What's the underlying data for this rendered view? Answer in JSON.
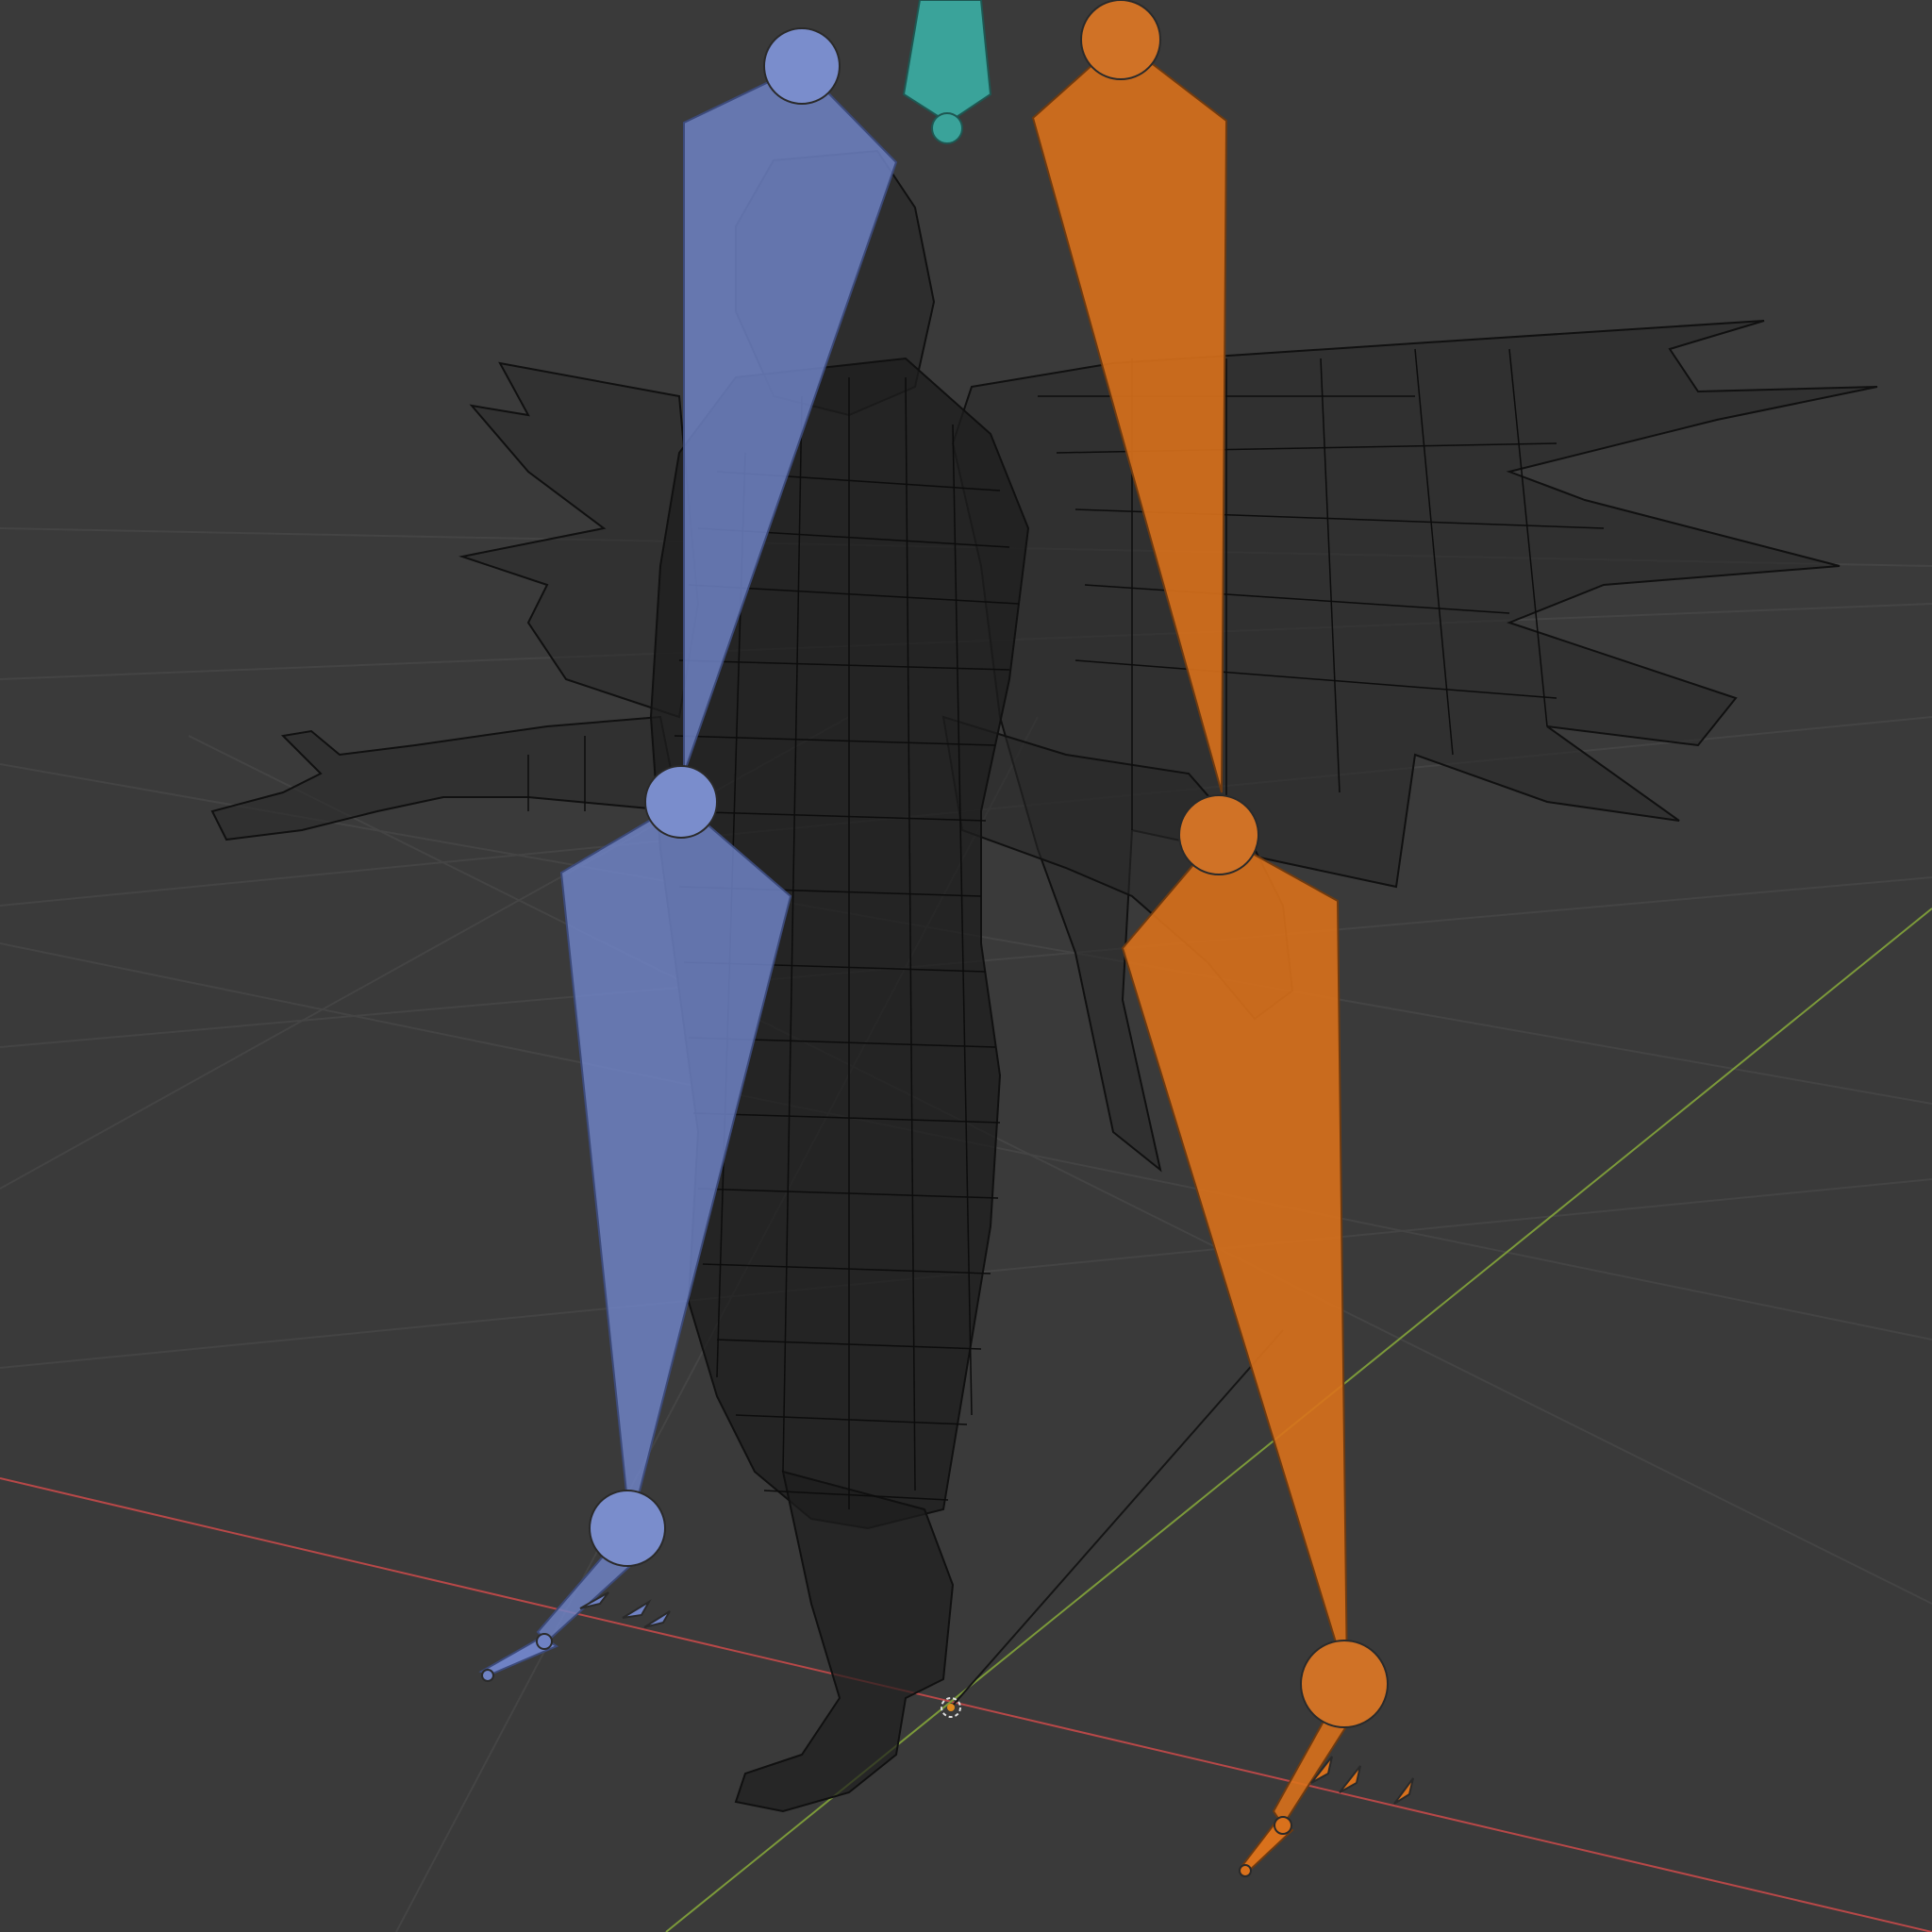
{
  "viewport": {
    "background": "#3a3a3a",
    "grid_color": "#444444",
    "x_axis_color": "#b84848",
    "y_axis_color": "#7c9a3a",
    "wireframe_color": "#101010"
  },
  "bones": {
    "left_leg_color": "#6f82c4",
    "right_leg_color": "#d9711c",
    "root_color": "#3aa39a"
  }
}
